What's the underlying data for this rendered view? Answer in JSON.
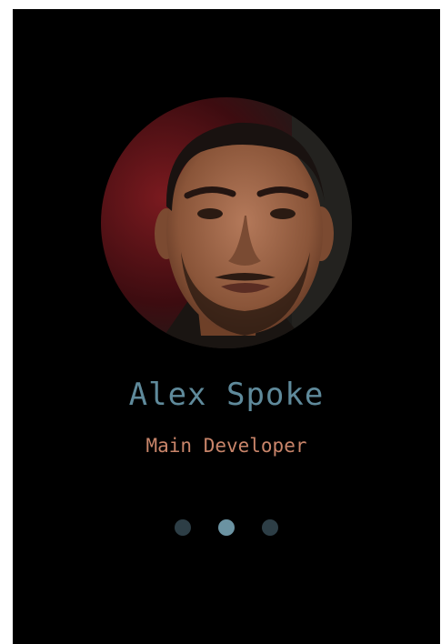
{
  "profile": {
    "name": "Alex Spoke",
    "role": "Main Developer"
  },
  "carousel": {
    "dot_count": 3,
    "active_index": 1
  },
  "colors": {
    "background": "#000000",
    "name": "#5f8a9b",
    "role": "#c9856a",
    "dot": "#2d3e46",
    "dot_active": "#6b93a2"
  },
  "icons": {
    "avatar": "person-photo"
  }
}
